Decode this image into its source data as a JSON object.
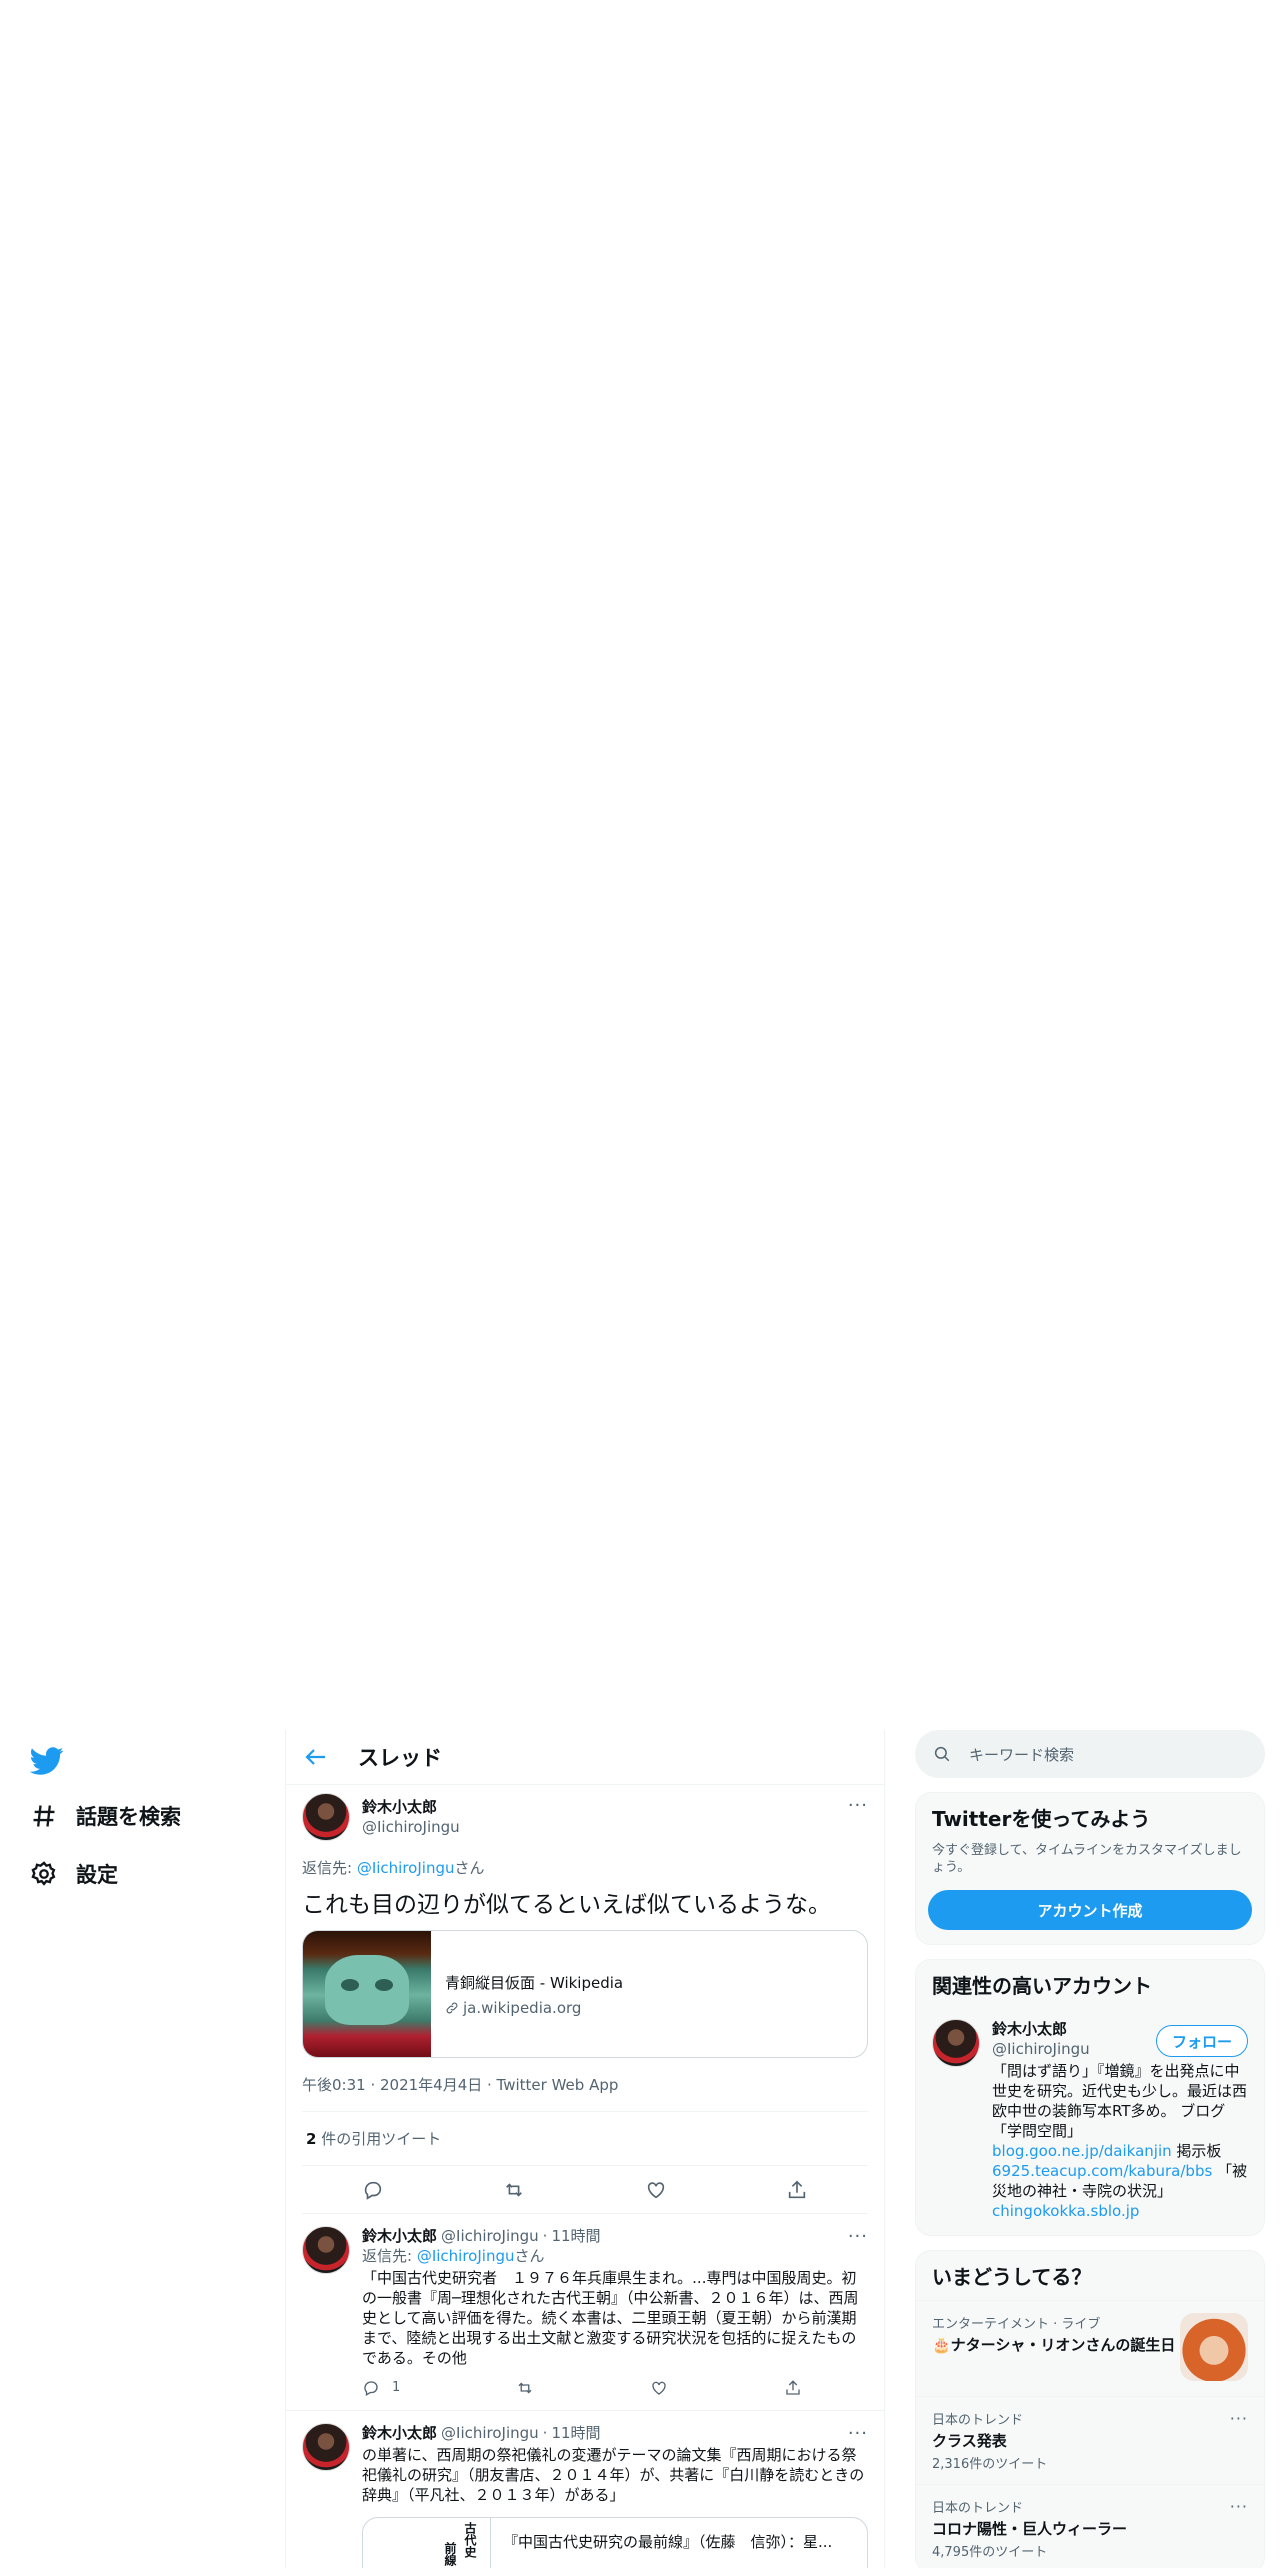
{
  "nav": {
    "explore_label": "話題を検索",
    "settings_label": "設定"
  },
  "header": {
    "title": "スレッド"
  },
  "main_tweet": {
    "author_name": "鈴木小太郎",
    "author_handle": "@IichiroJingu",
    "reply_prefix": "返信先: ",
    "reply_mention": "@IichiroJingu",
    "reply_suffix": "さん",
    "text": "これも目の辺りが似てるといえば似ているような。",
    "card_title": "青銅縦目仮面 - Wikipedia",
    "card_domain": "ja.wikipedia.org",
    "meta": "午後0:31 · 2021年4月4日 · Twitter Web App",
    "quote_count": "2",
    "quote_label": " 件の引用ツイート"
  },
  "replies": [
    {
      "author_name": "鈴木小太郎",
      "author_handle": "@IichiroJingu",
      "sep": "·",
      "time": "11時間",
      "reply_prefix": "返信先: ",
      "reply_mention": "@IichiroJingu",
      "reply_suffix": "さん",
      "text": "「中国古代史研究者　１９７６年兵庫県生まれ。...専門は中国殷周史。初の一般書『周─理想化された古代王朝』（中公新書、２０１６年）は、西周史として高い評価を得た。続く本書は、二里頭王朝（夏王朝）から前漢期まで、陸続と出現する出土文献と激変する研究状況を包括的に捉えたものである。その他",
      "reply_count": "1"
    },
    {
      "author_name": "鈴木小太郎",
      "author_handle": "@IichiroJingu",
      "sep": "·",
      "time": "11時間",
      "text": "の単著に、西周期の祭祀儀礼の変遷がテーマの論文集『西周期における祭祀儀礼の研究』（朋友書店、２０１４年）が、共著に『白川静を読むときの辞典』（平凡社、２０１３年）がある」",
      "card_title": "『中国古代史研究の最前線』（佐藤　信弥）：星...",
      "book_col1": "古代史",
      "book_col2": "前線"
    }
  ],
  "right": {
    "search_placeholder": "キーワード検索",
    "signup": {
      "title": "Twitterを使ってみよう",
      "subtitle": "今すぐ登録して、タイムラインをカスタマイズしましょう。",
      "button": "アカウント作成"
    },
    "related": {
      "title": "関連性の高いアカウント",
      "name": "鈴木小太郎",
      "handle": "@IichiroJingu",
      "follow": "フォロー",
      "bio_1": "「問はず語り」『増鏡』を出発点に中世史を研究。近代史も少し。最近は西欧中世の装飾写本RT多め。 ブログ「学問空間」",
      "bio_link_1": "blog.goo.ne.jp/daikanjin",
      "bio_2": " 掲示板 ",
      "bio_link_2": "6925.teacup.com/kabura/bbs",
      "bio_3": " 「被災地の神社・寺院の状況」",
      "bio_link_3": "chingokokka.sblo.jp"
    },
    "trends": {
      "title": "いまどうしてる？",
      "items": [
        {
          "context": "エンターテイメント · ライブ",
          "name": "🎂ナターシャ・リオンさんの誕生日",
          "count": ""
        },
        {
          "context": "日本のトレンド",
          "name": "クラス発表",
          "count": "2,316件のツイート"
        },
        {
          "context": "日本のトレンド",
          "name": "コロナ陽性・巨人ウィーラー",
          "count": "4,795件のツイート"
        }
      ]
    }
  },
  "colors": {
    "accent": "#1d9bf0",
    "text": "#0f1419",
    "muted": "#536471"
  }
}
